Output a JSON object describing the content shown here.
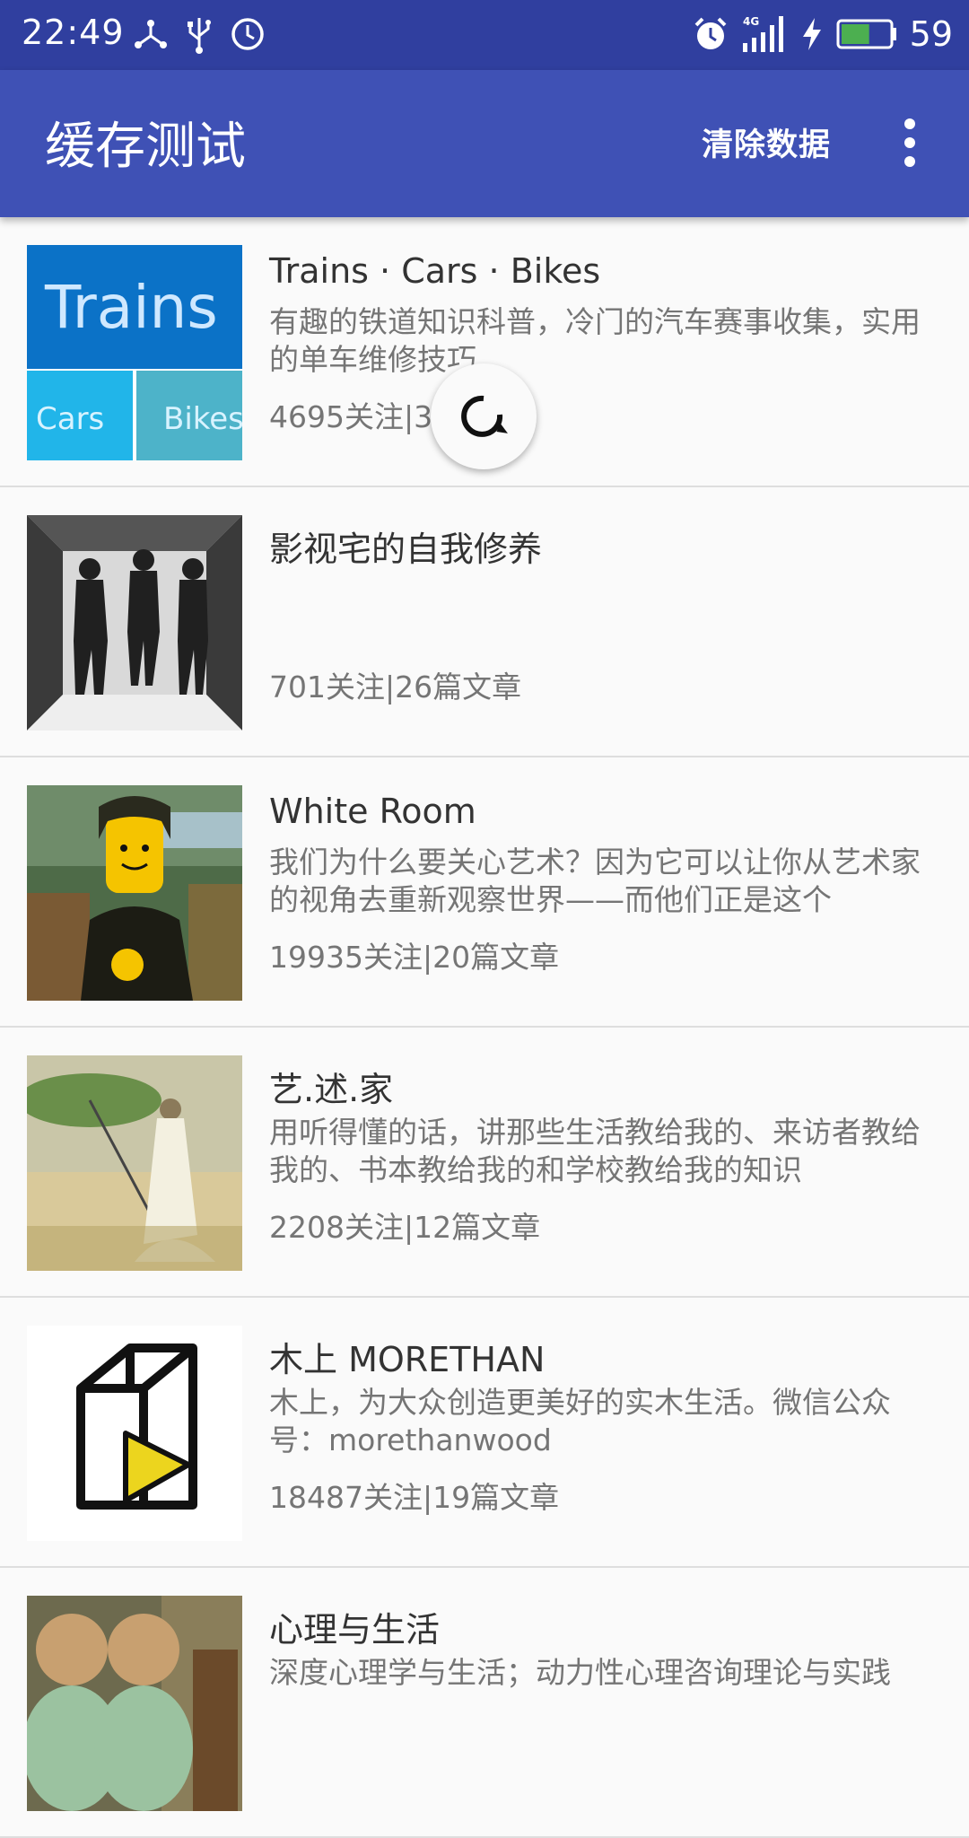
{
  "status_bar": {
    "time": "22:49",
    "network": "4G",
    "battery": "59",
    "battery_color": "#4caf50"
  },
  "app_bar": {
    "title": "缓存测试",
    "action_clear": "清除数据",
    "color": "#3f51b5"
  },
  "items": [
    {
      "title": "Trains · Cars · Bikes",
      "description": "有趣的铁道知识科普，冷门的汽车赛事收集，实用的单车维修技巧",
      "meta": "4695关注|3",
      "thumb_text": [
        "Trains",
        "Cars",
        "Bikes"
      ]
    },
    {
      "title": "影视宅的自我修养",
      "description": "",
      "meta": "701关注|26篇文章"
    },
    {
      "title": "White Room",
      "description": "我们为什么要关心艺术？因为它可以让你从艺术家的视角去重新观察世界——而他们正是这个",
      "meta": "19935关注|20篇文章"
    },
    {
      "title": "艺.述.家",
      "description": "用听得懂的话，讲那些生活教给我的、来访者教给我的、书本教给我的和学校教给我的知识",
      "meta": "2208关注|12篇文章"
    },
    {
      "title": "木上 MORETHAN",
      "description": "木上，为大众创造更美好的实木生活。微信公众号：morethanwood",
      "meta": "18487关注|19篇文章"
    },
    {
      "title": "心理与生活",
      "description": "深度心理学与生活；动力性心理咨询理论与实践",
      "meta": ""
    }
  ]
}
